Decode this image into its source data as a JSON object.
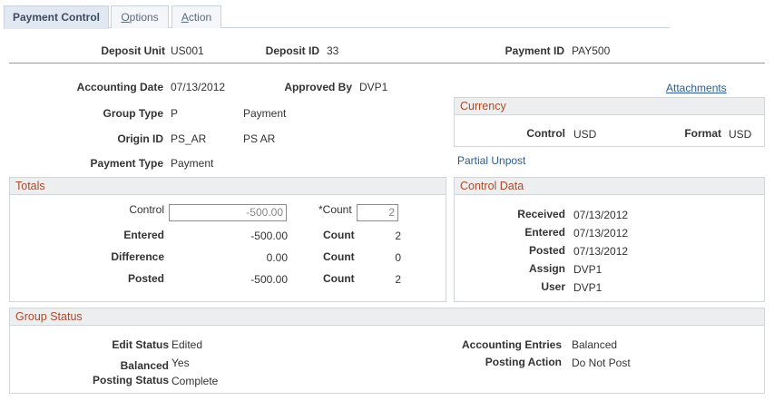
{
  "tabs": {
    "payment_control": "Payment Control",
    "options_prefix": "O",
    "options_rest": "ptions",
    "action_prefix": "A",
    "action_rest": "ction"
  },
  "header": {
    "deposit_unit_label": "Deposit Unit",
    "deposit_unit_value": "US001",
    "deposit_id_label": "Deposit ID",
    "deposit_id_value": "33",
    "payment_id_label": "Payment ID",
    "payment_id_value": "PAY500"
  },
  "details": {
    "accounting_date_label": "Accounting Date",
    "accounting_date_value": "07/13/2012",
    "approved_by_label": "Approved By",
    "approved_by_value": "DVP1",
    "group_type_label": "Group Type",
    "group_type_code": "P",
    "group_type_desc": "Payment",
    "origin_id_label": "Origin ID",
    "origin_id_code": "PS_AR",
    "origin_id_desc": "PS AR",
    "payment_type_label": "Payment Type",
    "payment_type_value": "Payment",
    "attachments_link": "Attachments",
    "partial_unpost_link": "Partial Unpost"
  },
  "currency": {
    "title": "Currency",
    "control_label": "Control",
    "control_value": "USD",
    "format_label": "Format",
    "format_value": "USD"
  },
  "totals": {
    "title": "Totals",
    "control_label": "Control",
    "control_amount": "-500.00",
    "count_label_required": "*Count",
    "control_count": "2",
    "entered_label": "Entered",
    "entered_amount": "-500.00",
    "entered_count_label": "Count",
    "entered_count": "2",
    "difference_label": "Difference",
    "difference_amount": "0.00",
    "difference_count_label": "Count",
    "difference_count": "0",
    "posted_label": "Posted",
    "posted_amount": "-500.00",
    "posted_count_label": "Count",
    "posted_count": "2"
  },
  "control_data": {
    "title": "Control Data",
    "received_label": "Received",
    "received_value": "07/13/2012",
    "entered_label": "Entered",
    "entered_value": "07/13/2012",
    "posted_label": "Posted",
    "posted_value": "07/13/2012",
    "assign_label": "Assign",
    "assign_value": "DVP1",
    "user_label": "User",
    "user_value": "DVP1"
  },
  "group_status": {
    "title": "Group Status",
    "edit_status_label": "Edit Status",
    "edit_status_value": "Edited",
    "balanced_label": "Balanced",
    "balanced_value": "Yes",
    "posting_status_label": "Posting Status",
    "posting_status_value": "Complete",
    "accounting_entries_label": "Accounting Entries",
    "accounting_entries_value": "Balanced",
    "posting_action_label": "Posting Action",
    "posting_action_value": "Do Not Post"
  },
  "colors": {
    "group_title": "#a94b2b",
    "link": "#2a5d8f",
    "tab_active_bg": "#e1e8f1",
    "group_header_bg": "#eceef0"
  }
}
